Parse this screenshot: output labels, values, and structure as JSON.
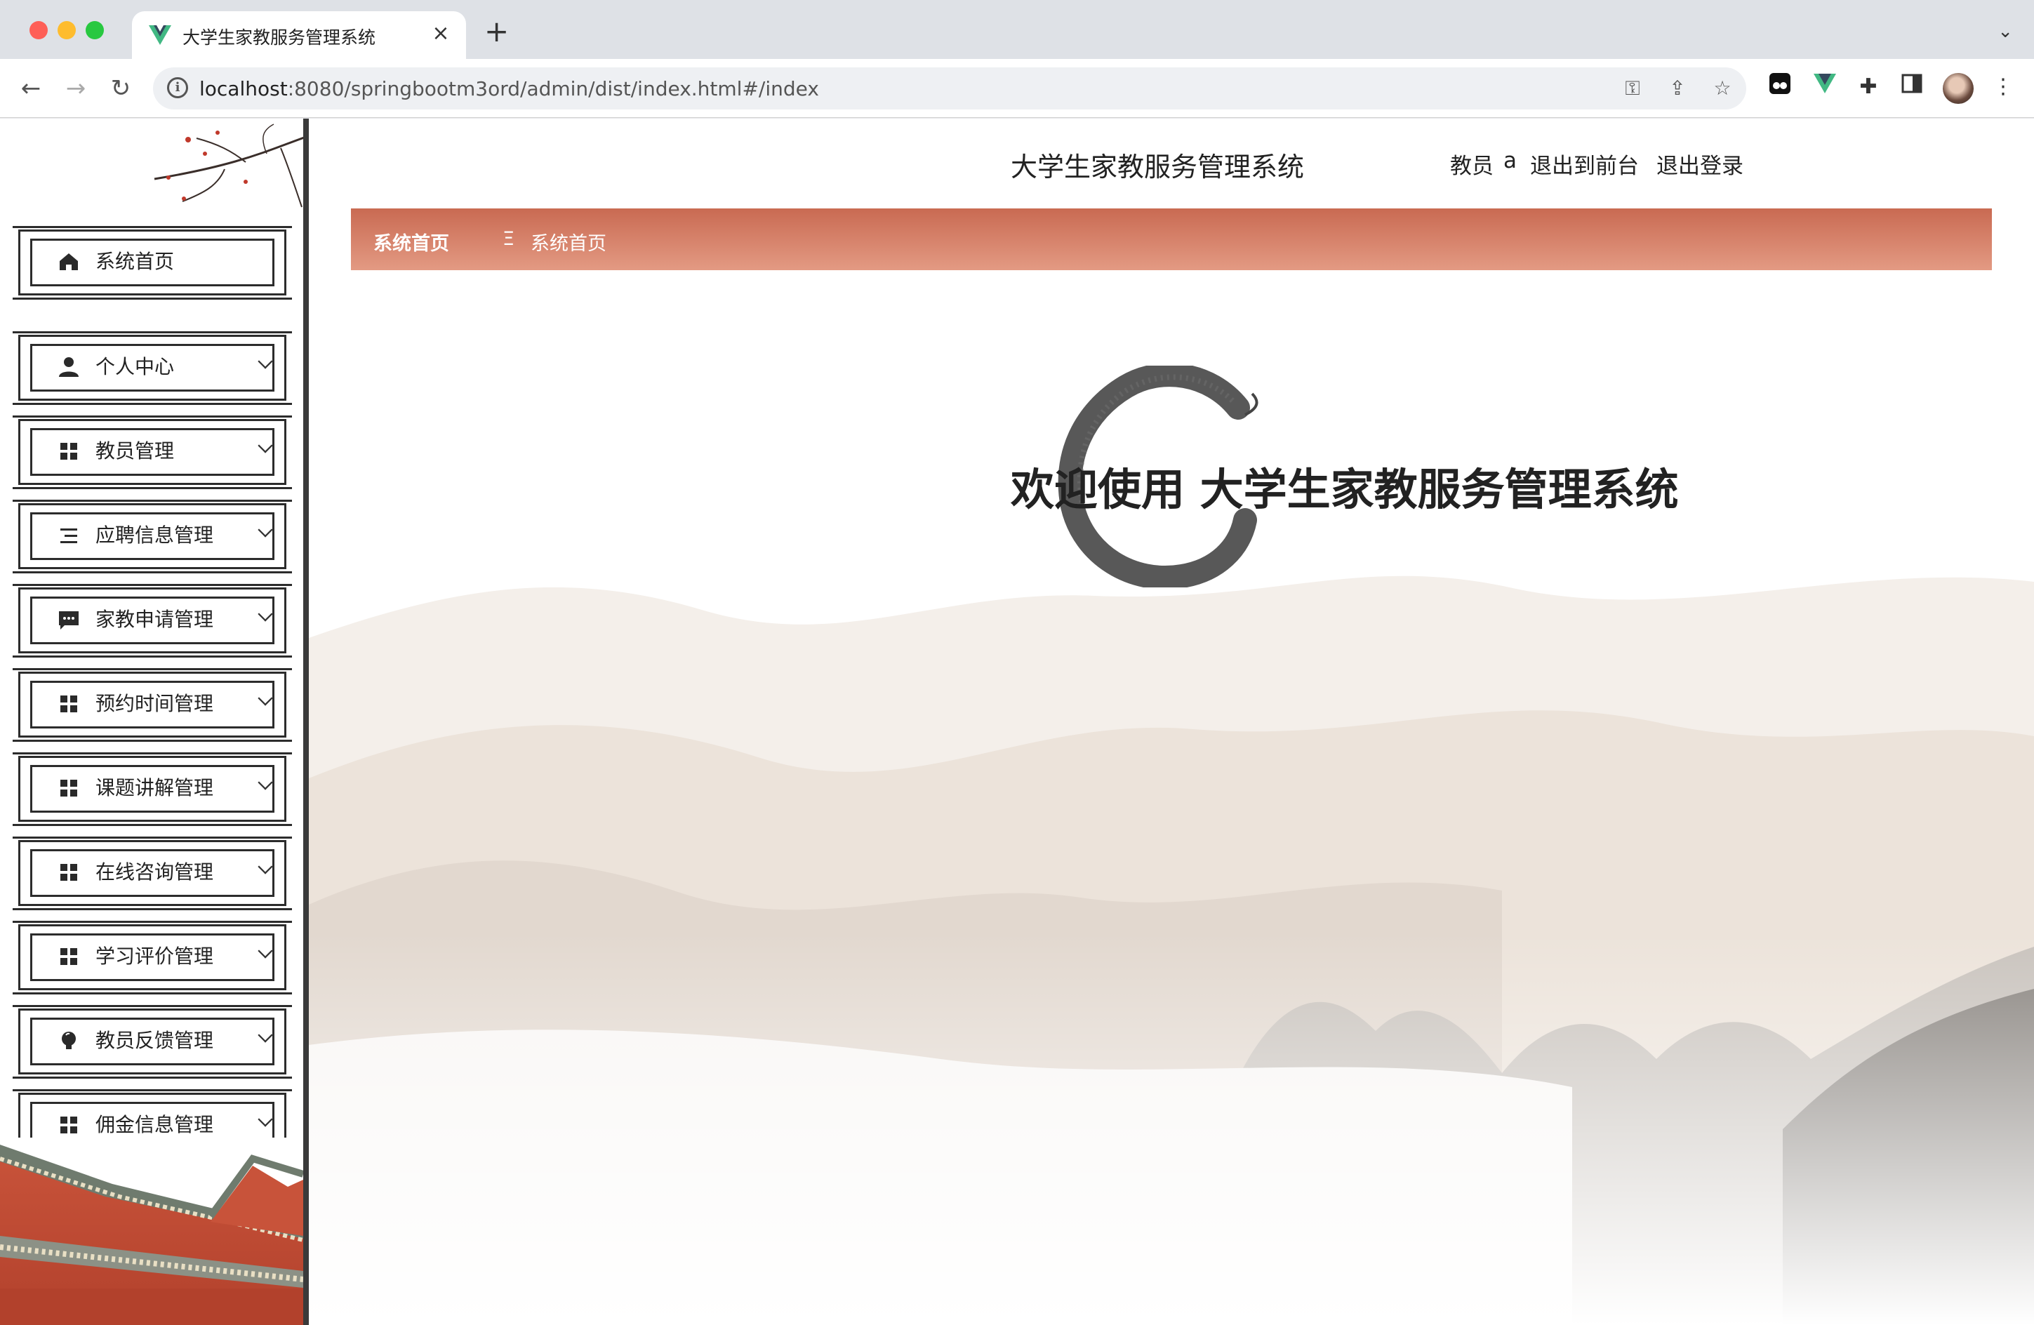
{
  "browser": {
    "tab_title": "大学生家教服务管理系统",
    "tab_close": "×",
    "new_tab": "+",
    "url_host": "localhost",
    "url_rest": ":8080/springbootm3ord/admin/dist/index.html#/index",
    "icons": [
      "back-icon",
      "forward-icon",
      "reload-icon",
      "site-info-icon",
      "key-icon",
      "share-icon",
      "star-icon",
      "extension-icon",
      "vue-devtools-icon",
      "puzzle-icon",
      "side-panel-icon",
      "avatar",
      "more-icon"
    ]
  },
  "header": {
    "site_title": "大学生家教服务管理系统",
    "user_role": "教员",
    "user_name": "a",
    "link_front": "退出到前台",
    "link_logout": "退出登录"
  },
  "breadcrumb": {
    "home": "系统首页",
    "separator": "Ξ",
    "current": "系统首页",
    "gradient_top": "#c96a52",
    "gradient_bottom": "#e39a83"
  },
  "welcome": {
    "text": "欢迎使用 大学生家教服务管理系统"
  },
  "sidebar": {
    "items": [
      {
        "label": "系统首页",
        "icon": "home-icon",
        "expandable": false
      },
      {
        "label": "个人中心",
        "icon": "user-icon",
        "expandable": true
      },
      {
        "label": "教员管理",
        "icon": "grid-icon",
        "expandable": true
      },
      {
        "label": "应聘信息管理",
        "icon": "list-icon",
        "expandable": true
      },
      {
        "label": "家教申请管理",
        "icon": "chat-icon",
        "expandable": true
      },
      {
        "label": "预约时间管理",
        "icon": "grid-icon",
        "expandable": true
      },
      {
        "label": "课题讲解管理",
        "icon": "grid-icon",
        "expandable": true
      },
      {
        "label": "在线咨询管理",
        "icon": "grid-icon",
        "expandable": true
      },
      {
        "label": "学习评价管理",
        "icon": "grid-icon",
        "expandable": true
      },
      {
        "label": "教员反馈管理",
        "icon": "bulb-icon",
        "expandable": true
      },
      {
        "label": "佣金信息管理",
        "icon": "grid-icon",
        "expandable": true
      }
    ]
  }
}
